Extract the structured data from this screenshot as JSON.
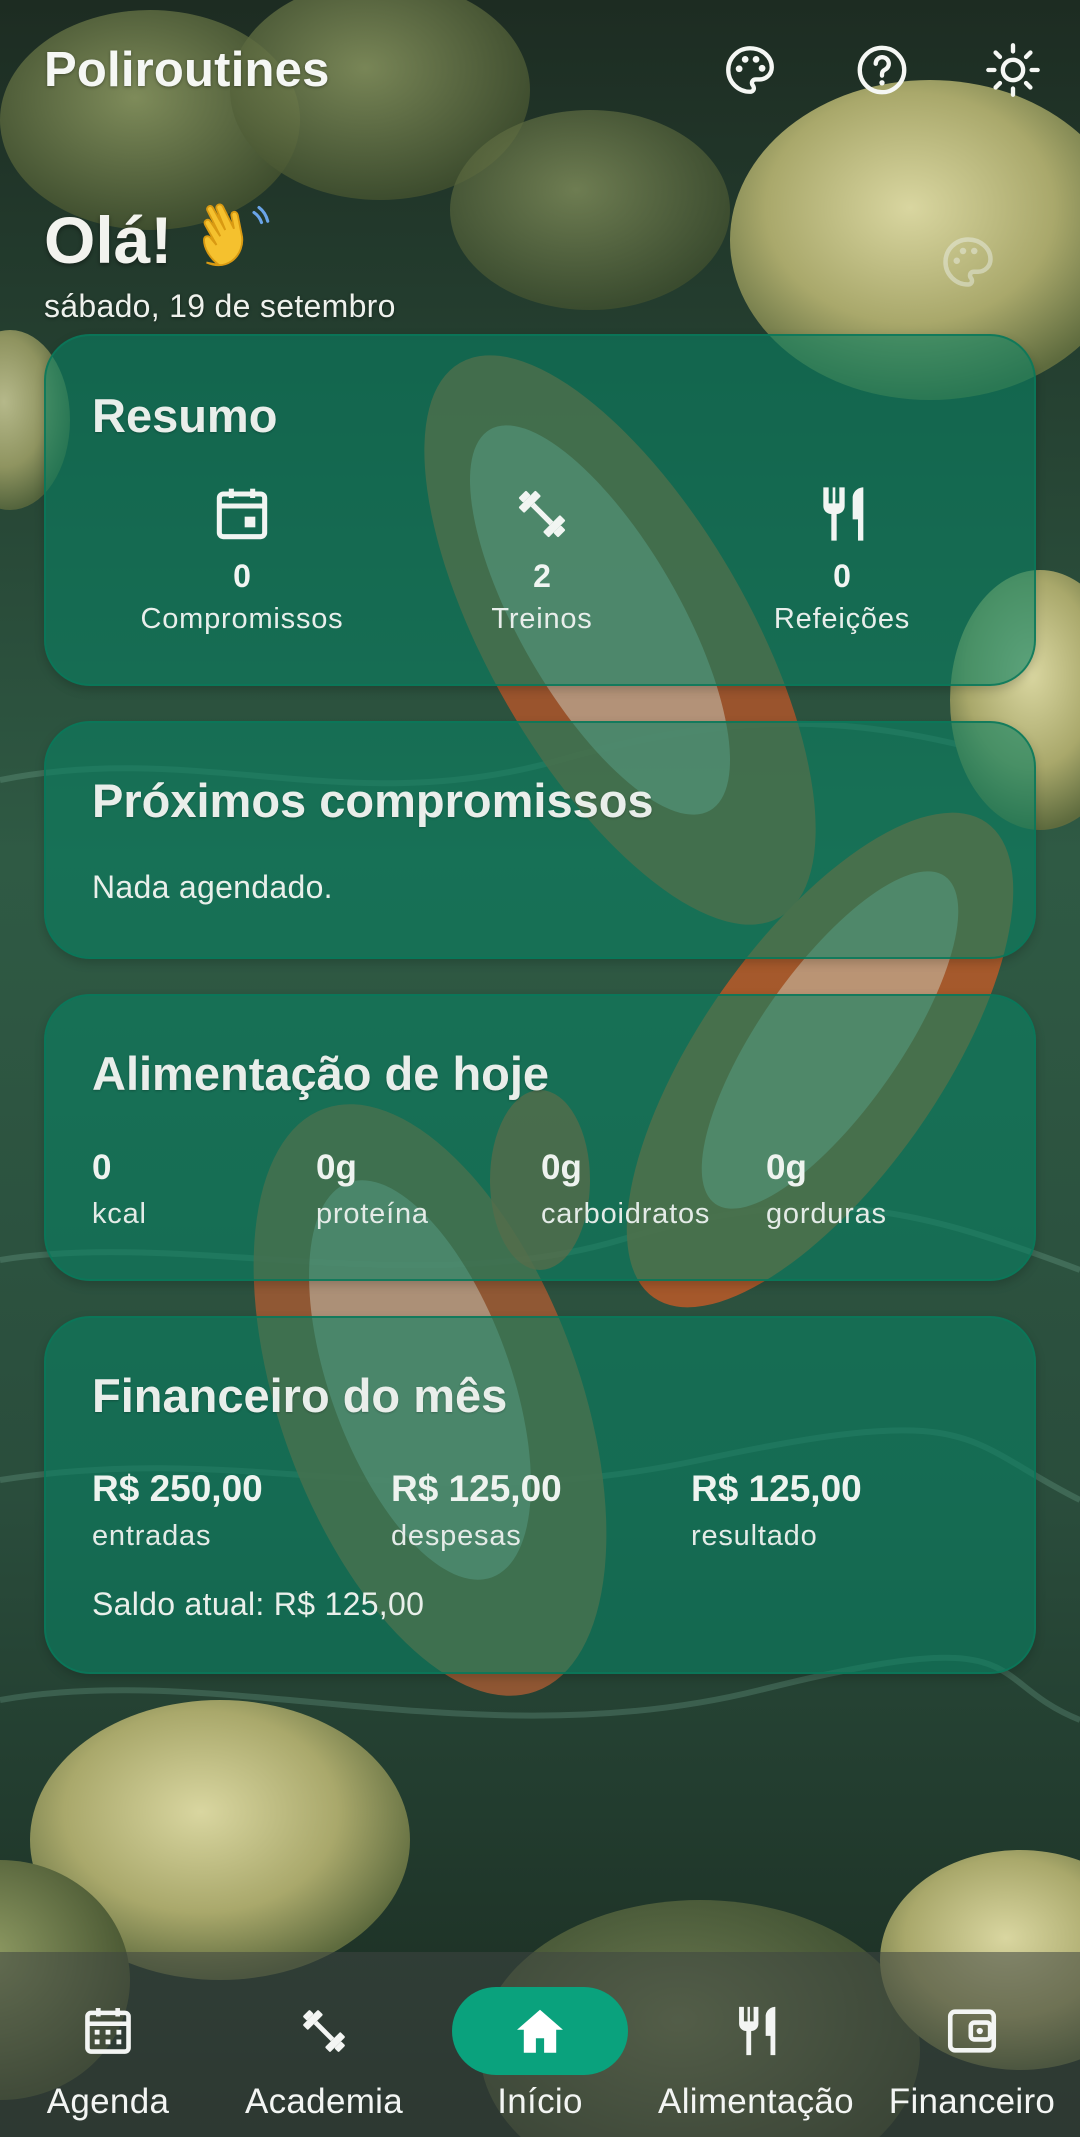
{
  "app": {
    "title": "Poliroutines",
    "icons": [
      "palette-icon",
      "help-icon",
      "brightness-icon"
    ]
  },
  "greeting": {
    "text": "Olá!",
    "emoji": "waving-hand-icon",
    "date": "sábado, 19 de setembro"
  },
  "summary": {
    "title": "Resumo",
    "items": [
      {
        "icon": "calendar-icon",
        "value": "0",
        "label": "Compromissos"
      },
      {
        "icon": "dumbbell-icon",
        "value": "2",
        "label": "Treinos"
      },
      {
        "icon": "restaurant-icon",
        "value": "0",
        "label": "Refeições"
      }
    ]
  },
  "upcoming": {
    "title": "Próximos compromissos",
    "empty_text": "Nada agendado."
  },
  "food": {
    "title": "Alimentação de hoje",
    "items": [
      {
        "value": "0",
        "label": "kcal"
      },
      {
        "value": "0g",
        "label": "proteína"
      },
      {
        "value": "0g",
        "label": "carboidratos"
      },
      {
        "value": "0g",
        "label": "gorduras"
      }
    ]
  },
  "finance": {
    "title": "Financeiro do mês",
    "items": [
      {
        "value": "R$ 250,00",
        "label": "entradas"
      },
      {
        "value": "R$ 125,00",
        "label": "despesas"
      },
      {
        "value": "R$ 125,00",
        "label": "resultado"
      }
    ],
    "balance": "Saldo atual: R$ 125,00"
  },
  "nav": {
    "items": [
      {
        "label": "Agenda",
        "icon": "calendar-icon"
      },
      {
        "label": "Academia",
        "icon": "dumbbell-icon"
      },
      {
        "label": "Início",
        "icon": "home-icon",
        "active": true
      },
      {
        "label": "Alimentação",
        "icon": "restaurant-icon"
      },
      {
        "label": "Financeiro",
        "icon": "wallet-icon"
      }
    ]
  },
  "colors": {
    "card_bg": "#08805f",
    "nav_active": "#0aa27d",
    "text": "#f2f4f2"
  }
}
